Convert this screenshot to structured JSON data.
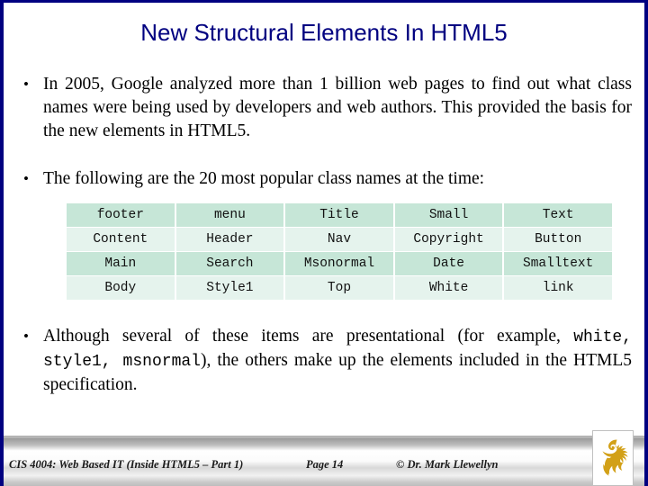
{
  "slide": {
    "title": "New Structural Elements In HTML5",
    "accent_color": "#000080",
    "background_color": "#ffffff"
  },
  "bullets": [
    {
      "marker": "•",
      "text": "In 2005, Google analyzed more than 1 billion web pages to find out what class names were being used by  developers and web authors.  This provided the basis for the new elements in HTML5."
    },
    {
      "marker": "•",
      "text": "The following are the 20 most popular class names at the time:"
    }
  ],
  "closing_bullet": {
    "marker": "•",
    "part1": "Although several of these items are presentational (for example, ",
    "mono": "white,  style1,  msnormal",
    "part2": "), the others make up the elements included in the HTML5 specification."
  },
  "class_table": {
    "row_dark_color": "#c6e6d7",
    "row_light_color": "#e5f3ed",
    "rows": [
      {
        "style": "dark",
        "cells": [
          "footer",
          "menu",
          "Title",
          "Small",
          "Text"
        ]
      },
      {
        "style": "light",
        "cells": [
          "Content",
          "Header",
          "Nav",
          "Copyright",
          "Button"
        ]
      },
      {
        "style": "dark",
        "cells": [
          "Main",
          "Search",
          "Msonormal",
          "Date",
          "Smalltext"
        ]
      },
      {
        "style": "light",
        "cells": [
          "Body",
          "Style1",
          "Top",
          "White",
          "link"
        ]
      }
    ]
  },
  "footer": {
    "course": "CIS 4004: Web Based IT (Inside HTML5 – Part 1)",
    "page": "Page 14",
    "copyright": "© Dr. Mark Llewellyn",
    "logo_name": "pegasus-logo",
    "logo_color": "#D2A017"
  }
}
